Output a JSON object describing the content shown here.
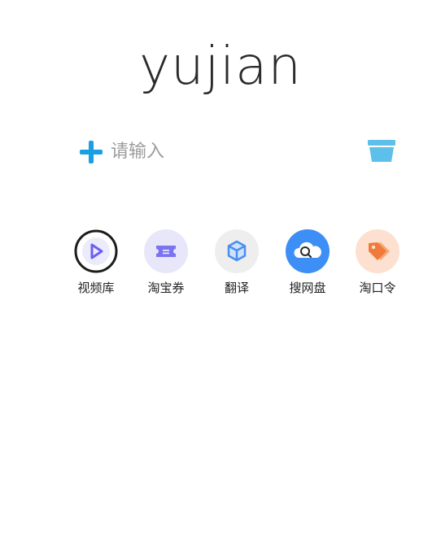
{
  "logo": {
    "text": "yujian"
  },
  "search": {
    "placeholder": "请输入",
    "value": ""
  },
  "icons": {
    "add": "plus-icon",
    "clear": "trash-icon"
  },
  "shortcuts": [
    {
      "label": "视频库",
      "icon": "video-play-icon",
      "color": "#6b5ff5"
    },
    {
      "label": "淘宝券",
      "icon": "coupon-icon",
      "color": "#7b73f0"
    },
    {
      "label": "翻译",
      "icon": "cube-icon",
      "color": "#4a8ef0"
    },
    {
      "label": "搜网盘",
      "icon": "cloud-search-icon",
      "color": "#3d8ef5"
    },
    {
      "label": "淘口令",
      "icon": "tag-icon",
      "color": "#f07a3a"
    }
  ],
  "colors": {
    "accent": "#1a9fe0",
    "trash": "#5cc0ea"
  }
}
